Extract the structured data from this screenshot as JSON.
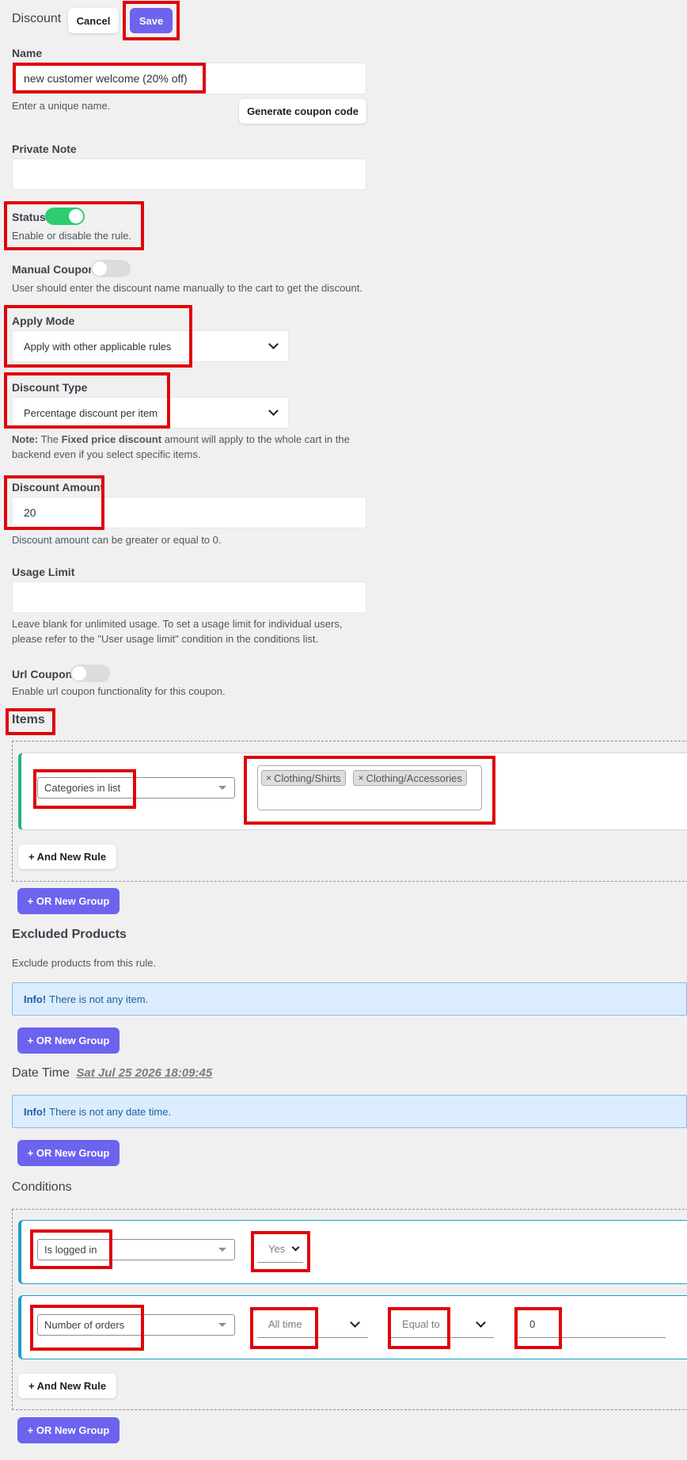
{
  "header": {
    "title": "Discount",
    "cancel_label": "Cancel",
    "save_label": "Save"
  },
  "name": {
    "label": "Name",
    "value": "new customer welcome (20% off)",
    "help": "Enter a unique name.",
    "generate_label": "Generate coupon code"
  },
  "private_note": {
    "label": "Private Note",
    "value": ""
  },
  "status": {
    "label": "Status",
    "enabled": true,
    "help": "Enable or disable the rule."
  },
  "manual_coupon": {
    "label": "Manual Coupon",
    "enabled": false,
    "help": "User should enter the discount name manually to the cart to get the discount."
  },
  "apply_mode": {
    "label": "Apply Mode",
    "value": "Apply with other applicable rules"
  },
  "discount_type": {
    "label": "Discount Type",
    "value": "Percentage discount per item",
    "note_bold": "Note:",
    "note_pre": "The",
    "note_strong": "Fixed price discount",
    "note_post": "amount will apply to the whole cart in the",
    "note_line2": "backend even if you select specific items."
  },
  "discount_amount": {
    "label": "Discount Amount",
    "value": "20",
    "help": "Discount amount can be greater or equal to 0."
  },
  "usage_limit": {
    "label": "Usage Limit",
    "value": "",
    "help_line1": "Leave blank for unlimited usage. To set a usage limit for individual users,",
    "help_line2": "please refer to the \"User usage limit\" condition in the conditions list."
  },
  "url_coupon": {
    "label": "Url Coupon",
    "enabled": false,
    "help": "Enable url coupon functionality for this coupon."
  },
  "items": {
    "heading": "Items",
    "rule_type": "Categories in list",
    "tags": [
      "Clothing/Shirts",
      "Clothing/Accessories"
    ],
    "and_rule_label": "+ And New Rule",
    "or_group_label": "+ OR New Group"
  },
  "excluded": {
    "heading": "Excluded Products",
    "help": "Exclude products from this rule.",
    "info_bold": "Info!",
    "info_text": "There is not any item.",
    "or_group_label": "+ OR New Group"
  },
  "datetime": {
    "heading": "Date Time",
    "value": "Sat Jul 25 2026 18:09:45",
    "info_bold": "Info!",
    "info_text": "There is not any date time.",
    "or_group_label": "+ OR New Group"
  },
  "conditions": {
    "heading": "Conditions",
    "rule1": {
      "type": "Is logged in",
      "value": "Yes"
    },
    "rule2": {
      "type": "Number of orders",
      "period": "All time",
      "operator": "Equal to",
      "value": "0"
    },
    "and_rule_label": "+ And New Rule",
    "or_group_label": "+ OR New Group"
  },
  "colors": {
    "primary": "#6c63ef",
    "toggle_on": "#2ecc71",
    "toggle_off": "#dcdcde",
    "highlight": "#e0040b"
  }
}
